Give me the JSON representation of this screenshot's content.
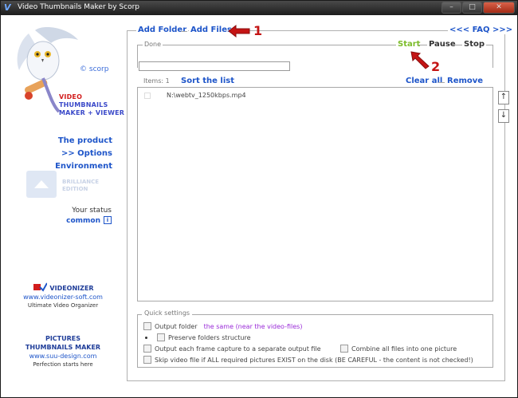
{
  "window": {
    "title": "Video Thumbnails Maker by Scorp"
  },
  "titlebar_buttons": {
    "minimize": "–",
    "maximize": "□",
    "close": "✕"
  },
  "sidebar": {
    "scorp_label": "scorp",
    "product_lines": [
      "VIDEO",
      "THUMBNAILS",
      "MAKER + VIEWER"
    ],
    "nav": {
      "the_product": "The product",
      "options": ">> Options",
      "environment": "Environment"
    },
    "brilliance": [
      "BRILLIANCE",
      "EDITION"
    ],
    "status_label": "Your status",
    "status_value": "common",
    "status_icon": "i",
    "videonizer": {
      "title": "VIDEONIZER",
      "url": "www.videonizer-soft.com",
      "tagline": "Ultimate Video Organizer"
    },
    "pictures": {
      "title_lines": [
        "PICTURES",
        "THUMBNAILS MAKER"
      ],
      "url": "www.suu-design.com",
      "tagline": "Perfection starts here"
    }
  },
  "toolbar": {
    "add_folder": "Add Folder",
    "add_files": "Add Files",
    "faq": "<<< FAQ >>>",
    "done_label": "Done",
    "start": "Start",
    "pause": "Pause",
    "stop": "Stop"
  },
  "list": {
    "items_label": "Items: 1",
    "sort": "Sort the list",
    "clear_all": "Clear all",
    "remove": "Remove",
    "files": [
      "N:\\webtv_1250kbps.mp4"
    ],
    "move_up": "↑",
    "move_down": "↓"
  },
  "quick_settings": {
    "title": "Quick settings",
    "output_folder": "Output folder",
    "output_folder_value": "the same (near the video-files)",
    "preserve": "Preserve folders structure",
    "each_frame": "Output each frame capture to a separate output file",
    "combine": "Combine all files into one picture",
    "skip": "Skip video file if ALL required pictures EXIST on the disk (BE CAREFUL - the content is not checked!)"
  },
  "annotations": {
    "one": "1",
    "two": "2"
  },
  "colors": {
    "link": "#1e55c9",
    "start": "#7cbc2a",
    "annotation": "#c41414"
  }
}
